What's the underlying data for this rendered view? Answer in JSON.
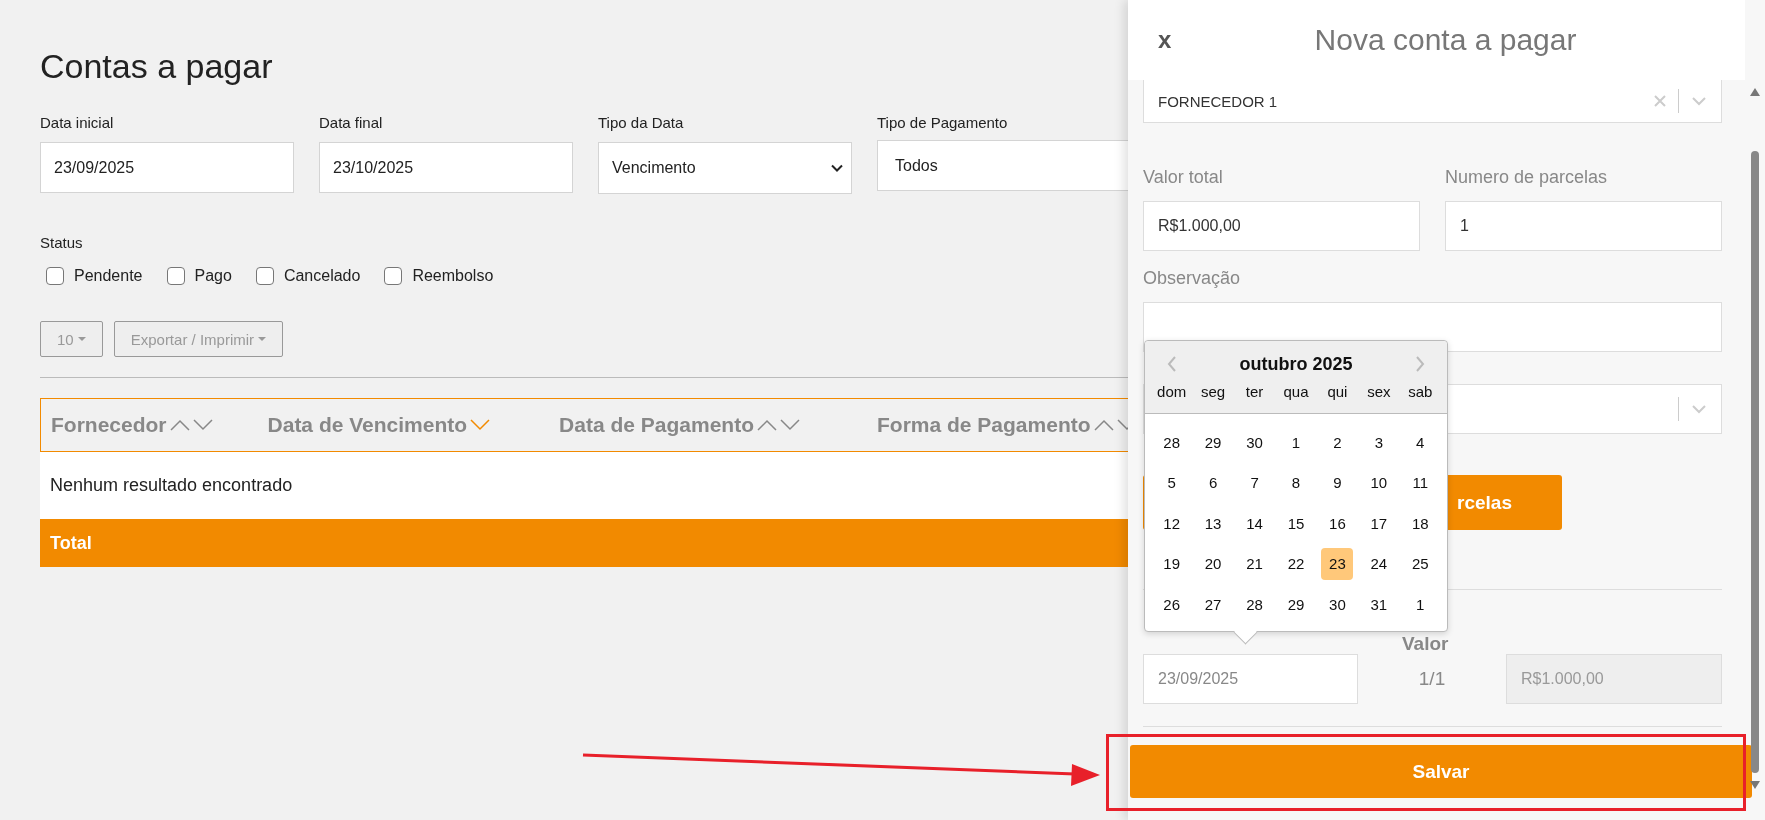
{
  "page": {
    "title": "Contas a pagar"
  },
  "filters": [
    {
      "label": "Data inicial",
      "kind": "text",
      "value": "23/09/2025"
    },
    {
      "label": "Data final",
      "kind": "text",
      "value": "23/10/2025"
    },
    {
      "label": "Tipo da Data",
      "kind": "select",
      "value": "Vencimento"
    },
    {
      "label": "Tipo de Pagamento",
      "kind": "text",
      "value": "Todos"
    }
  ],
  "status": {
    "label": "Status",
    "options": [
      {
        "label": "Pendente",
        "checked": false
      },
      {
        "label": "Pago",
        "checked": false
      },
      {
        "label": "Cancelado",
        "checked": false
      },
      {
        "label": "Reembolso",
        "checked": false
      }
    ]
  },
  "toolbar": {
    "page_size": "10",
    "export": "Exportar / Imprimir"
  },
  "table": {
    "columns": [
      {
        "label": "Fornecedor",
        "sorted": false
      },
      {
        "label": "Data de Vencimento",
        "sorted": true
      },
      {
        "label": "Data de Pagamento",
        "sorted": false
      },
      {
        "label": "Forma de Pagamento",
        "sorted": false
      }
    ],
    "empty_message": "Nenhum resultado encontrado",
    "total_label": "Total"
  },
  "drawer": {
    "close": "x",
    "title": "Nova conta a pagar",
    "supplier": {
      "value": "FORNECEDOR 1"
    },
    "fields": [
      {
        "label": "Valor total",
        "value": "R$1.000,00"
      },
      {
        "label": "Numero de parcelas",
        "value": "1"
      }
    ],
    "note": {
      "label": "Observação"
    },
    "generate_button": "rcelas",
    "installments": {
      "value_header": "Valor",
      "rows": [
        {
          "date": "23/09/2025",
          "number": "1/1",
          "amount": "R$1.000,00"
        }
      ]
    },
    "save_button": "Salvar"
  },
  "datepicker": {
    "month": "outubro 2025",
    "weekdays": [
      "dom",
      "seg",
      "ter",
      "qua",
      "qui",
      "sex",
      "sab"
    ],
    "weeks": [
      [
        {
          "day": "28",
          "selected": false
        },
        {
          "day": "29",
          "selected": false
        },
        {
          "day": "30",
          "selected": false
        },
        {
          "day": "1",
          "selected": false
        },
        {
          "day": "2",
          "selected": false
        },
        {
          "day": "3",
          "selected": false
        },
        {
          "day": "4",
          "selected": false
        }
      ],
      [
        {
          "day": "5",
          "selected": false
        },
        {
          "day": "6",
          "selected": false
        },
        {
          "day": "7",
          "selected": false
        },
        {
          "day": "8",
          "selected": false
        },
        {
          "day": "9",
          "selected": false
        },
        {
          "day": "10",
          "selected": false
        },
        {
          "day": "11",
          "selected": false
        }
      ],
      [
        {
          "day": "12",
          "selected": false
        },
        {
          "day": "13",
          "selected": false
        },
        {
          "day": "14",
          "selected": false
        },
        {
          "day": "15",
          "selected": false
        },
        {
          "day": "16",
          "selected": false
        },
        {
          "day": "17",
          "selected": false
        },
        {
          "day": "18",
          "selected": false
        }
      ],
      [
        {
          "day": "19",
          "selected": false
        },
        {
          "day": "20",
          "selected": false
        },
        {
          "day": "21",
          "selected": false
        },
        {
          "day": "22",
          "selected": false
        },
        {
          "day": "23",
          "selected": true
        },
        {
          "day": "24",
          "selected": false
        },
        {
          "day": "25",
          "selected": false
        }
      ],
      [
        {
          "day": "26",
          "selected": false
        },
        {
          "day": "27",
          "selected": false
        },
        {
          "day": "28",
          "selected": false
        },
        {
          "day": "29",
          "selected": false
        },
        {
          "day": "30",
          "selected": false
        },
        {
          "day": "31",
          "selected": false
        },
        {
          "day": "1",
          "selected": false
        }
      ]
    ]
  }
}
